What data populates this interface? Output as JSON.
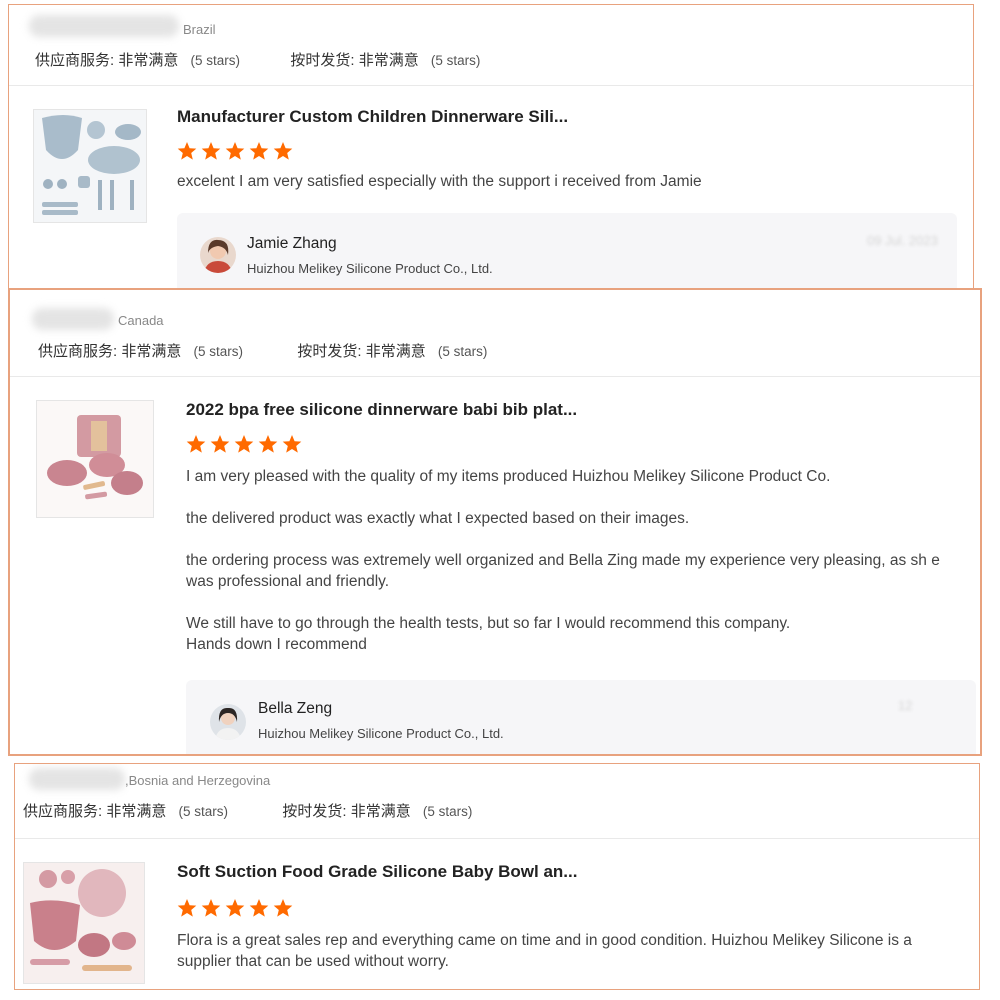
{
  "reviews": [
    {
      "country": "Brazil",
      "supplier_service": {
        "label": "供应商服务:",
        "value": "非常满意",
        "stars": "(5 stars)"
      },
      "on_time": {
        "label": "按时发货:",
        "value": "非常满意",
        "stars": "(5 stars)"
      },
      "product_title": "Manufacturer Custom Children Dinnerware Sili...",
      "rating": 5,
      "text": [
        "excelent I am very satisfied especially with the support i received from Jamie"
      ],
      "reply": {
        "name": "Jamie Zhang",
        "company": "Huizhou Melikey Silicone Product Co., Ltd.",
        "date": "09 Jul. 2023"
      }
    },
    {
      "country": "Canada",
      "supplier_service": {
        "label": "供应商服务:",
        "value": "非常满意",
        "stars": "(5 stars)"
      },
      "on_time": {
        "label": "按时发货:",
        "value": "非常满意",
        "stars": "(5 stars)"
      },
      "product_title": "2022 bpa free silicone dinnerware babi bib plat...",
      "rating": 5,
      "text": [
        "I am very pleased with the quality of my items produced Huizhou Melikey Silicone Product Co.",
        "the delivered product was exactly what I expected based on their images.",
        "the ordering process was extremely well organized and Bella Zing made my experience very pleasing, as sh e was professional and friendly.",
        "We still have to go through the health tests, but so far I would recommend this company.\nHands down I recommend"
      ],
      "reply": {
        "name": "Bella Zeng",
        "company": "Huizhou Melikey Silicone Product Co., Ltd.",
        "date": "12"
      }
    },
    {
      "country": ",Bosnia and Herzegovina",
      "supplier_service": {
        "label": "供应商服务:",
        "value": "非常满意",
        "stars": "(5 stars)"
      },
      "on_time": {
        "label": "按时发货:",
        "value": "非常满意",
        "stars": "(5 stars)"
      },
      "product_title": "Soft Suction Food Grade Silicone Baby Bowl an...",
      "rating": 5,
      "text": [
        "Flora is a great sales rep and everything came on time and in good condition. Huizhou Melikey Silicone is a supplier that can be used without worry."
      ]
    }
  ],
  "colors": {
    "star": "#ff6a00",
    "card_border": "#e8a27e",
    "reply_bg": "#f6f6f8"
  }
}
